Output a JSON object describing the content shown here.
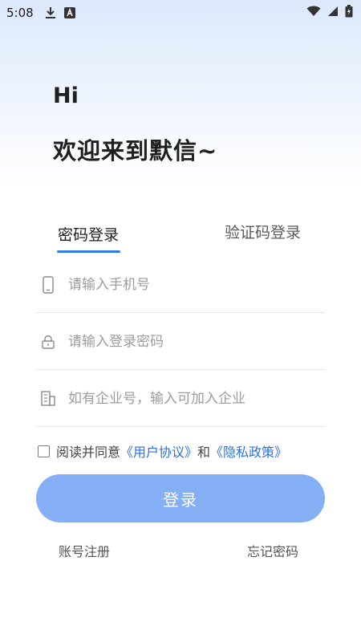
{
  "status_bar": {
    "time": "5:08",
    "icons": [
      "download-icon",
      "font-a-icon",
      "wifi-icon",
      "battery-icon"
    ]
  },
  "greeting": {
    "hi": "Hi",
    "welcome": "欢迎来到默信~"
  },
  "tabs": [
    {
      "label": "密码登录",
      "active": true
    },
    {
      "label": "验证码登录",
      "active": false
    }
  ],
  "form": {
    "phone": {
      "placeholder": "请输入手机号",
      "value": "",
      "icon": "phone-icon"
    },
    "password": {
      "placeholder": "请输入登录密码",
      "value": "",
      "icon": "lock-icon"
    },
    "company": {
      "placeholder": "如有企业号，输入可加入企业",
      "value": "",
      "icon": "building-icon"
    }
  },
  "agreement": {
    "checked": false,
    "prefix": "阅读并同意",
    "user_agreement": "《用户协议》",
    "and": "和",
    "privacy_policy": "《隐私政策》"
  },
  "login_button": "登录",
  "links": {
    "register": "账号注册",
    "forgot": "忘记密码"
  },
  "colors": {
    "accent": "#2f7bea",
    "button": "#84aff5",
    "link": "#2f6fe0"
  }
}
